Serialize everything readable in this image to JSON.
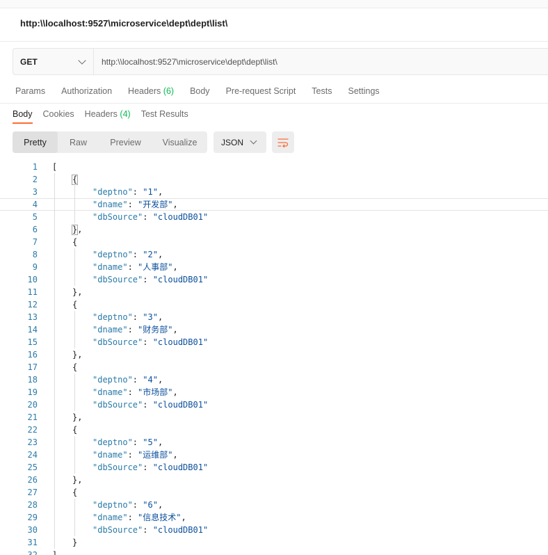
{
  "request": {
    "title": "http:\\\\localhost:9527\\microservice\\dept\\dept\\list\\",
    "method": "GET",
    "url": "http:\\\\localhost:9527\\microservice\\dept\\dept\\list\\"
  },
  "request_tabs": [
    {
      "label": "Params",
      "count": ""
    },
    {
      "label": "Authorization",
      "count": ""
    },
    {
      "label": "Headers",
      "count": "(6)"
    },
    {
      "label": "Body",
      "count": ""
    },
    {
      "label": "Pre-request Script",
      "count": ""
    },
    {
      "label": "Tests",
      "count": ""
    },
    {
      "label": "Settings",
      "count": ""
    }
  ],
  "response_tabs": [
    {
      "label": "Body",
      "count": "",
      "active": true
    },
    {
      "label": "Cookies",
      "count": "",
      "active": false
    },
    {
      "label": "Headers",
      "count": "(4)",
      "active": false
    },
    {
      "label": "Test Results",
      "count": "",
      "active": false
    }
  ],
  "view_modes": [
    {
      "label": "Pretty",
      "active": true
    },
    {
      "label": "Raw",
      "active": false
    },
    {
      "label": "Preview",
      "active": false
    },
    {
      "label": "Visualize",
      "active": false
    }
  ],
  "format": "JSON",
  "icons": {
    "wrap": "wrap-lines-icon",
    "wrap_color": "#ff6c37"
  },
  "response_body": [
    {
      "deptno": "1",
      "dname": "开发部",
      "dbSource": "cloudDB01"
    },
    {
      "deptno": "2",
      "dname": "人事部",
      "dbSource": "cloudDB01"
    },
    {
      "deptno": "3",
      "dname": "财务部",
      "dbSource": "cloudDB01"
    },
    {
      "deptno": "4",
      "dname": "市场部",
      "dbSource": "cloudDB01"
    },
    {
      "deptno": "5",
      "dname": "运维部",
      "dbSource": "cloudDB01"
    },
    {
      "deptno": "6",
      "dname": "信息技术",
      "dbSource": "cloudDB01"
    }
  ]
}
